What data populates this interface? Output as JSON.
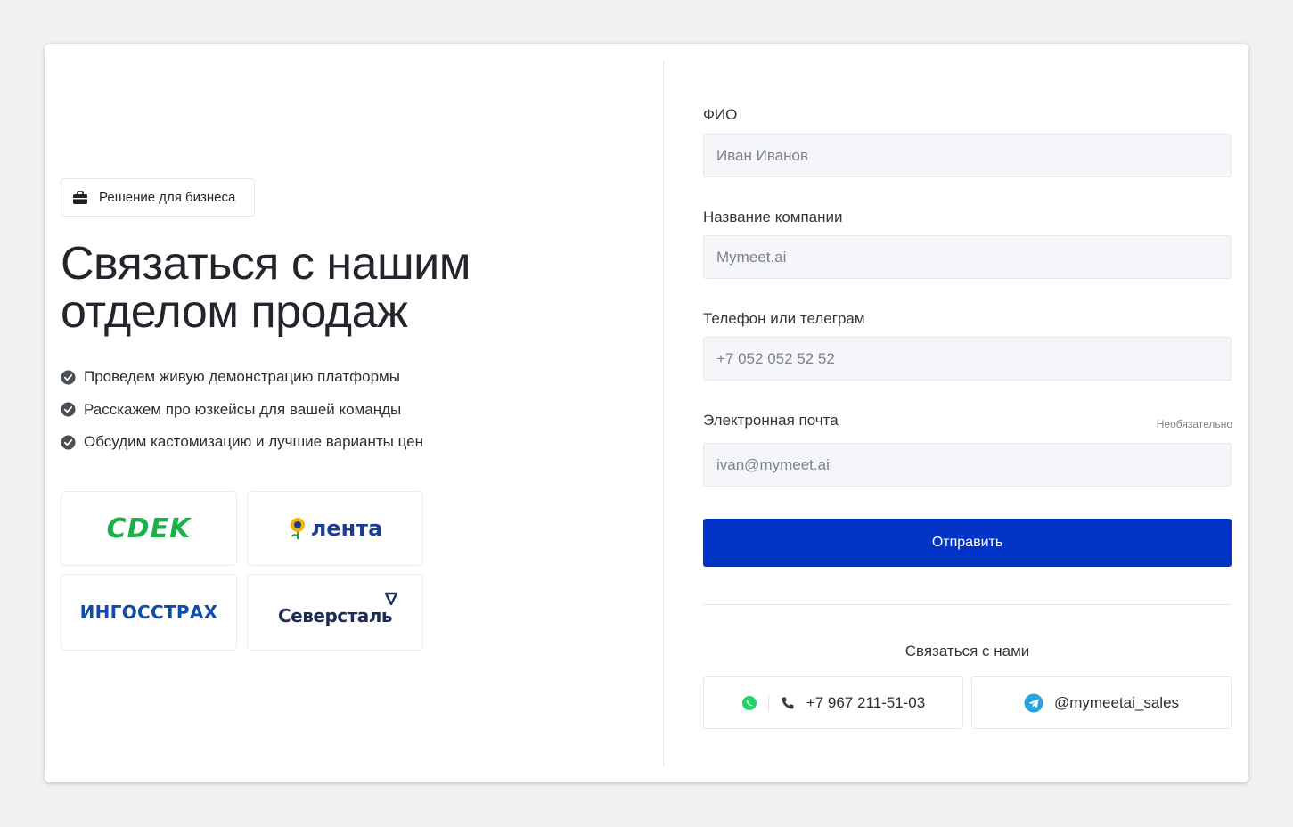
{
  "badge": {
    "label": "Решение для бизнеса",
    "icon": "briefcase-icon"
  },
  "hero": {
    "line1": "Связаться с нашим",
    "line2": "отделом продаж"
  },
  "bullets": [
    "Проведем живую демонстрацию платформы",
    "Расскажем про юзкейсы для вашей команды",
    "Обсудим кастомизацию и лучшие варианты цен"
  ],
  "logos": {
    "cdek": "CDEK",
    "lenta": "лента",
    "ingosstrakh": "ИНГОССТРАХ",
    "severstal": "Северсталь"
  },
  "form": {
    "fio": {
      "label": "ФИО",
      "placeholder": "Иван Иванов"
    },
    "company": {
      "label": "Название компании",
      "placeholder": "Mymeet.ai"
    },
    "phone": {
      "label": "Телефон или телеграм",
      "placeholder": "+7 052 052 52 52"
    },
    "email": {
      "label": "Электронная почта",
      "optional": "Необязательно",
      "placeholder": "ivan@mymeet.ai"
    },
    "submit": "Отправить"
  },
  "contacts": {
    "title": "Связаться с нами",
    "phone": "+7 967 211-51-03",
    "telegram": "@mymeetai_sales"
  },
  "colors": {
    "accent": "#0033c6",
    "cdek": "#1ab248",
    "lenta": "#1d3c8f",
    "ingosstrakh": "#0f4da8",
    "whatsapp": "#25d366",
    "telegram": "#2aa3de"
  }
}
